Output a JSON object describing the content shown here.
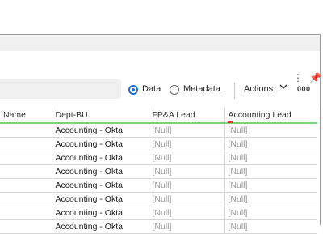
{
  "toolbar": {
    "radio_data_label": "Data",
    "radio_metadata_label": "Metadata",
    "actions_label": "Actions",
    "more_label": "000"
  },
  "table": {
    "columns": [
      "Name",
      "Dept-BU",
      "FP&A Lead",
      "Accounting Lead"
    ],
    "rows": [
      [
        "",
        "Accounting - Okta",
        "[Null]",
        "[Null]"
      ],
      [
        "",
        "Accounting - Okta",
        "[Null]",
        "[Null]"
      ],
      [
        "",
        "Accounting - Okta",
        "[Null]",
        "[Null]"
      ],
      [
        "",
        "Accounting - Okta",
        "[Null]",
        "[Null]"
      ],
      [
        "",
        "Accounting - Okta",
        "[Null]",
        "[Null]"
      ],
      [
        "",
        "Accounting - Okta",
        "[Null]",
        "[Null]"
      ],
      [
        "",
        "Accounting - Okta",
        "[Null]",
        "[Null]"
      ],
      [
        "",
        "Accounting - Okta",
        "[Null]",
        "[Null]"
      ]
    ]
  }
}
